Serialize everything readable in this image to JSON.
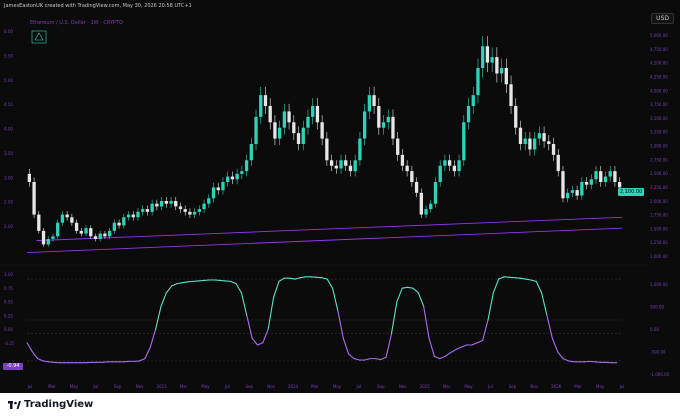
{
  "header": {
    "text": "JamesEastonUK created with TradingView.com, May 30, 2026 20:58 UTC+1",
    "currency": "USD"
  },
  "footer": {
    "brand": "TradingView"
  },
  "colors": {
    "background": "#0b0b0b",
    "up_candle": "#2fd3b8",
    "trendline": "#9b30ff",
    "oscillator_high": "#5fe0c5",
    "oscillator_low": "#a96ff0"
  },
  "chart_data": [
    {
      "type": "candlestick",
      "title": "Ethereum / U.S. Dollar · 1W · CRYPTO",
      "x_ticks": [
        "Jul",
        "Mar",
        "May",
        "Jul",
        "Sep",
        "Nov",
        "2023",
        "Mar",
        "May",
        "Jul",
        "Sep",
        "Nov",
        "2024",
        "Mar",
        "May",
        "Jul",
        "Sep",
        "Nov",
        "2025",
        "Mar",
        "May",
        "Jul",
        "Sep",
        "Nov",
        "2026",
        "Mar",
        "May",
        "Jul"
      ],
      "y_ticks_left": [
        "6.00",
        "5.50",
        "5.00",
        "4.50",
        "4.00",
        "3.50",
        "3.00",
        "2.50",
        "2.00"
      ],
      "y_ticks_right": [
        "5,000.00",
        "4,750.00",
        "4,500.00",
        "4,250.00",
        "4,000.00",
        "3,750.00",
        "3,500.00",
        "3,250.00",
        "3,000.00",
        "2,750.00",
        "2,500.00",
        "2,250.00",
        "2,000.00",
        "1,750.00",
        "1,500.00",
        "1,250.00",
        "1,000.00"
      ],
      "ylim": [
        800,
        5000
      ],
      "last_price": "2,100.00",
      "closes": [
        2200,
        1600,
        1300,
        1050,
        1150,
        1200,
        1450,
        1600,
        1550,
        1450,
        1300,
        1250,
        1350,
        1200,
        1150,
        1250,
        1200,
        1300,
        1450,
        1400,
        1550,
        1600,
        1550,
        1650,
        1700,
        1650,
        1800,
        1750,
        1850,
        1800,
        1850,
        1750,
        1700,
        1650,
        1600,
        1650,
        1700,
        1800,
        1900,
        2100,
        2050,
        2200,
        2300,
        2250,
        2350,
        2400,
        2600,
        2900,
        3400,
        3800,
        3600,
        3300,
        3000,
        3200,
        3500,
        3300,
        3100,
        2900,
        3200,
        3400,
        3600,
        3300,
        3000,
        2600,
        2500,
        2450,
        2600,
        2500,
        2400,
        2600,
        3000,
        3500,
        3800,
        3600,
        3200,
        3300,
        3400,
        3000,
        2700,
        2500,
        2400,
        2200,
        2000,
        1600,
        1700,
        1800,
        2200,
        2500,
        2600,
        2500,
        2400,
        2600,
        3300,
        3600,
        3800,
        4300,
        4700,
        4400,
        4500,
        4200,
        4300,
        4000,
        3600,
        3200,
        2900,
        3000,
        2800,
        3000,
        3100,
        2950,
        2900,
        2700,
        2400,
        1900,
        2000,
        2050,
        1950,
        2200,
        2150,
        2250,
        2400,
        2200,
        2300,
        2400,
        2200,
        2100
      ],
      "trendlines": [
        {
          "from": [
            0,
            900
          ],
          "to": [
            126,
            1350
          ]
        },
        {
          "from": [
            2,
            1120
          ],
          "to": [
            126,
            1550
          ]
        }
      ]
    },
    {
      "type": "line",
      "y_ticks_left": [
        "1.00",
        "0.75",
        "0.50",
        "0.25",
        "0.00",
        "-0.25"
      ],
      "y_ticks_right": [
        "1,000.00",
        "500.00",
        "0.00",
        "-500.00",
        "-1,000.00"
      ],
      "last_value": "-0.94",
      "ylim": [
        -1.1,
        1.1
      ],
      "levels": [
        0.9,
        -0.9,
        0,
        -0.3
      ],
      "values": [
        -0.5,
        -0.7,
        -0.85,
        -0.9,
        -0.92,
        -0.93,
        -0.94,
        -0.94,
        -0.94,
        -0.94,
        -0.94,
        -0.94,
        -0.93,
        -0.93,
        -0.93,
        -0.92,
        -0.92,
        -0.92,
        -0.92,
        -0.91,
        -0.91,
        -0.9,
        -0.85,
        -0.6,
        -0.2,
        0.3,
        0.6,
        0.75,
        0.8,
        0.82,
        0.84,
        0.85,
        0.86,
        0.87,
        0.88,
        0.88,
        0.87,
        0.86,
        0.85,
        0.8,
        0.6,
        0.1,
        -0.4,
        -0.55,
        -0.5,
        -0.2,
        0.5,
        0.85,
        0.92,
        0.92,
        0.9,
        0.93,
        0.95,
        0.95,
        0.94,
        0.93,
        0.9,
        0.7,
        0.2,
        -0.4,
        -0.75,
        -0.85,
        -0.88,
        -0.88,
        -0.85,
        -0.85,
        -0.87,
        -0.82,
        -0.3,
        0.4,
        0.7,
        0.72,
        0.7,
        0.6,
        0.3,
        -0.4,
        -0.8,
        -0.85,
        -0.8,
        -0.72,
        -0.65,
        -0.6,
        -0.55,
        -0.55,
        -0.5,
        -0.45,
        0.0,
        0.6,
        0.9,
        0.95,
        0.94,
        0.93,
        0.92,
        0.9,
        0.88,
        0.85,
        0.6,
        0.1,
        -0.4,
        -0.7,
        -0.85,
        -0.9,
        -0.92,
        -0.92,
        -0.92,
        -0.91,
        -0.92,
        -0.93,
        -0.93,
        -0.94,
        -0.94
      ]
    }
  ]
}
